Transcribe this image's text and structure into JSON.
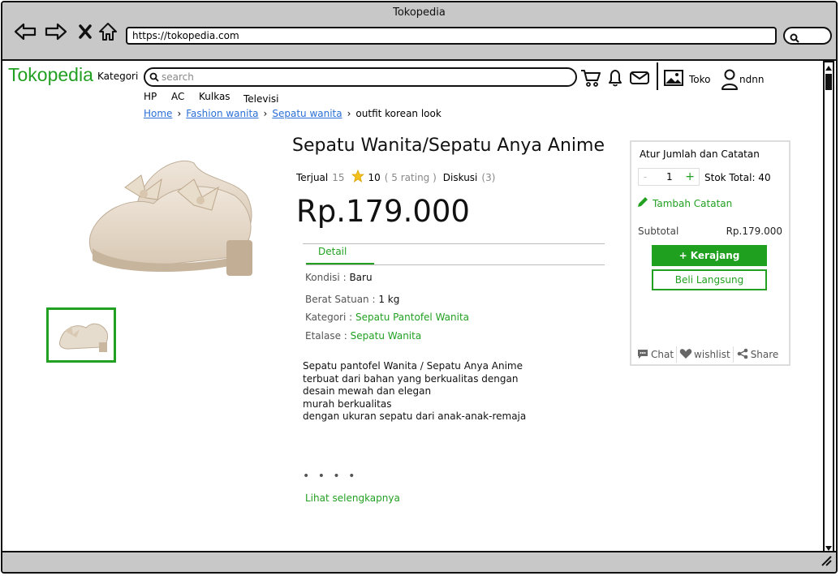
{
  "window": {
    "title": "Tokopedia"
  },
  "browser": {
    "url": "https://tokopedia.com"
  },
  "header": {
    "logo": "Tokopedia",
    "kategori": "Kategori",
    "search_placeholder": "search",
    "toko_label": "Toko",
    "user_name": "ndnn"
  },
  "quick_links": [
    "HP",
    "AC",
    "Kulkas",
    "Televisi"
  ],
  "breadcrumb": [
    "Home",
    "Fashion wanita",
    "Sepatu wanita",
    "outfit korean look"
  ],
  "product": {
    "title": "Sepatu Wanita/Sepatu Anya Anime",
    "terjual_label": "Terjual",
    "terjual_count": "15",
    "rating": "10",
    "rating_count": "( 5 rating )",
    "diskusi_label": "Diskusi",
    "diskusi_count": "(3)",
    "price": "Rp.179.000",
    "tab_detail": "Detail",
    "kondisi_label": "Kondisi :",
    "kondisi_value": "Baru",
    "berat_label": "Berat Satuan :",
    "berat_value": "1 kg",
    "kategori_label": "Kategori :",
    "kategori_value": "Sepatu Pantofel Wanita",
    "etalase_label": "Etalase :",
    "etalase_value": "Sepatu Wanita",
    "description": [
      "Sepatu pantofel Wanita / Sepatu Anya Anime",
      "terbuat dari bahan yang berkualitas dengan",
      "desain mewah dan elegan",
      "murah berkualitas",
      "dengan ukuran sepatu dari anak-anak-remaja"
    ],
    "dots": "• • • •",
    "more_link": "Lihat selengkapnya"
  },
  "cart_panel": {
    "title": "Atur Jumlah dan Catatan",
    "minus": "-",
    "quantity": "1",
    "plus": "+",
    "stok": "Stok Total: 40",
    "catatan": "Tambah Catatan",
    "subtotal_label": "Subtotal",
    "subtotal_value": "Rp.179.000",
    "cart_button": "+ Kerajang",
    "buy_button": "Beli Langsung",
    "chat": "Chat",
    "wishlist": "wishlist",
    "share": "Share"
  },
  "colors": {
    "brand_green": "#22a022",
    "link_blue": "#2a6fd6",
    "frame_gray": "#c8c8c8"
  }
}
